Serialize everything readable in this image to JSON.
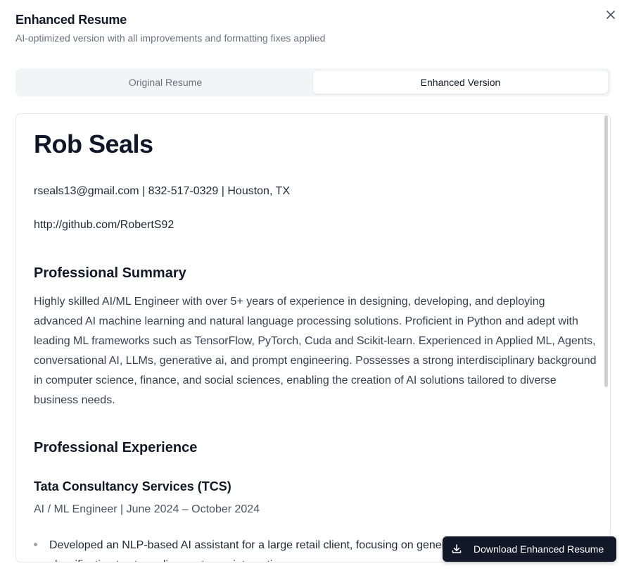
{
  "dialog": {
    "title": "Enhanced Resume",
    "subtitle": "AI-optimized version with all improvements and formatting fixes applied",
    "close_icon": "close-icon"
  },
  "tabs": [
    {
      "label": "Original Resume",
      "active": false
    },
    {
      "label": "Enhanced Version",
      "active": true
    }
  ],
  "resume": {
    "name": "Rob Seals",
    "contact": "rseals13@gmail.com | 832-517-0329 | Houston, TX",
    "github": "http://github.com/RobertS92",
    "summary_heading": "Professional Summary",
    "summary": "Highly skilled AI/ML Engineer with over 5+ years of experience in designing, developing, and deploying advanced AI machine learning and natural language processing solutions. Proficient in Python and adept with leading ML frameworks such as TensorFlow, PyTorch, Cuda and Scikit-learn. Experienced in Applied ML, Agents, conversational AI, LLMs, generative ai, and prompt engineering. Possesses a strong interdisciplinary background in computer science, finance, and social sciences, enabling the creation of AI solutions tailored to diverse business needs.",
    "experience_heading": "Professional Experience",
    "experience": [
      {
        "company": "Tata Consultancy Services (TCS)",
        "role": "AI / ML Engineer | June 2024 – October 2024",
        "bullets": [
          "Developed an NLP-based AI assistant for a large retail client, focusing on generative AI and intent classification to streamline customer interactions."
        ]
      }
    ]
  },
  "actions": {
    "download_label": "Download Enhanced Resume",
    "download_icon": "download-icon"
  },
  "colors": {
    "primary_button": "#111827",
    "tab_bg": "#f3f4f6",
    "muted_text": "#6b7280"
  }
}
